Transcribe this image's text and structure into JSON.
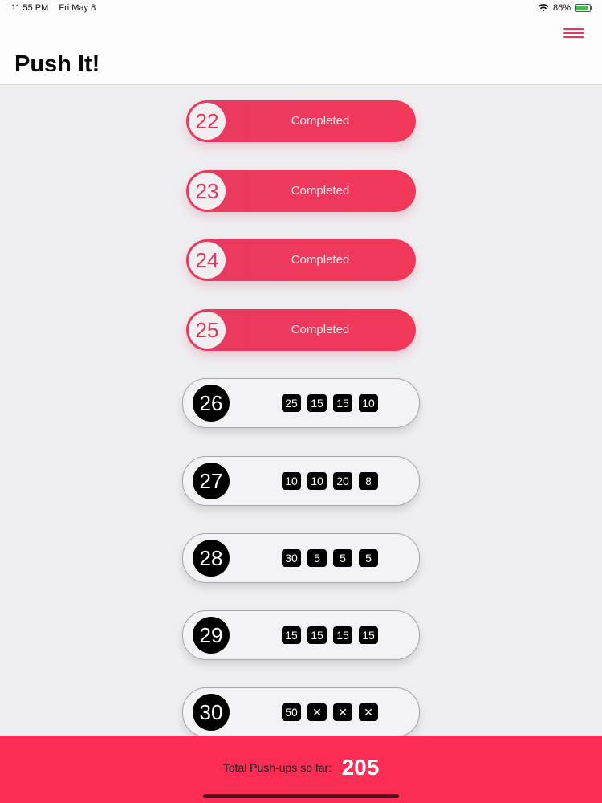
{
  "status": {
    "time": "11:55 PM",
    "date": "Fri May 8",
    "battery": "86%",
    "wifi_icon": "wifi-icon",
    "battery_icon": "battery-charging-icon"
  },
  "header": {
    "title": "Push It!",
    "menu_icon": "hamburger-menu-icon"
  },
  "completed_days": [
    {
      "day": "22",
      "status": "Completed"
    },
    {
      "day": "23",
      "status": "Completed"
    },
    {
      "day": "24",
      "status": "Completed"
    },
    {
      "day": "25",
      "status": "Completed"
    }
  ],
  "upcoming_days": [
    {
      "day": "26",
      "sets": [
        "25",
        "15",
        "15",
        "10"
      ]
    },
    {
      "day": "27",
      "sets": [
        "10",
        "10",
        "20",
        "8"
      ]
    },
    {
      "day": "28",
      "sets": [
        "30",
        "5",
        "5",
        "5"
      ]
    },
    {
      "day": "29",
      "sets": [
        "15",
        "15",
        "15",
        "15"
      ]
    },
    {
      "day": "30",
      "sets": [
        "50",
        "✕",
        "✕",
        "✕"
      ]
    }
  ],
  "footer": {
    "label": "Total Push-ups so far:",
    "total": "205"
  },
  "colors": {
    "accent": "#fb2d55",
    "pill": "#ef3a5d",
    "background": "#efeef0"
  }
}
